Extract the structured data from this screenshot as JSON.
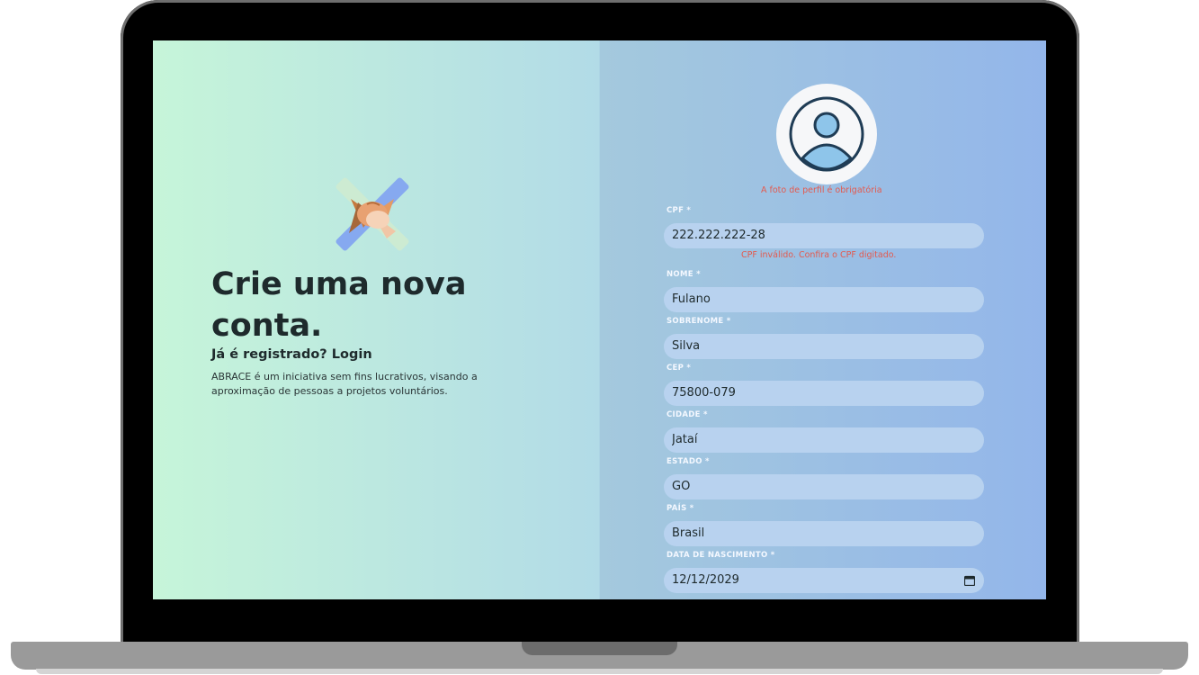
{
  "left": {
    "heading": "Crie uma nova conta.",
    "already_registered": "Já é registrado?",
    "login_link": "Login",
    "description": "ABRACE é um iniciativa sem fins lucrativos, visando a aproximação de pessoas a projetos voluntários."
  },
  "form": {
    "avatar_error": "A foto de perfil é obrigatória",
    "cpf_label": "CPF *",
    "cpf_value": "222.222.222-28",
    "cpf_error": "CPF inválido. Confira o CPF digitado.",
    "nome_label": "NOME *",
    "nome_value": "Fulano",
    "sobrenome_label": "SOBRENOME *",
    "sobrenome_value": "Silva",
    "cep_label": "CEP *",
    "cep_value": "75800-079",
    "cidade_label": "CIDADE *",
    "cidade_value": "Jataí",
    "estado_label": "ESTADO *",
    "estado_value": "GO",
    "pais_label": "PAÍS *",
    "pais_value": "Brasil",
    "nascimento_label": "DATA DE NASCIMENTO *",
    "nascimento_value": "12/12/2029"
  },
  "colors": {
    "accent_error": "#e35a4f",
    "field_bg": "#b8d2ef",
    "heading": "#1e2a2c"
  },
  "icons": [
    "hands-together-icon",
    "user-avatar-icon",
    "calendar-icon"
  ]
}
